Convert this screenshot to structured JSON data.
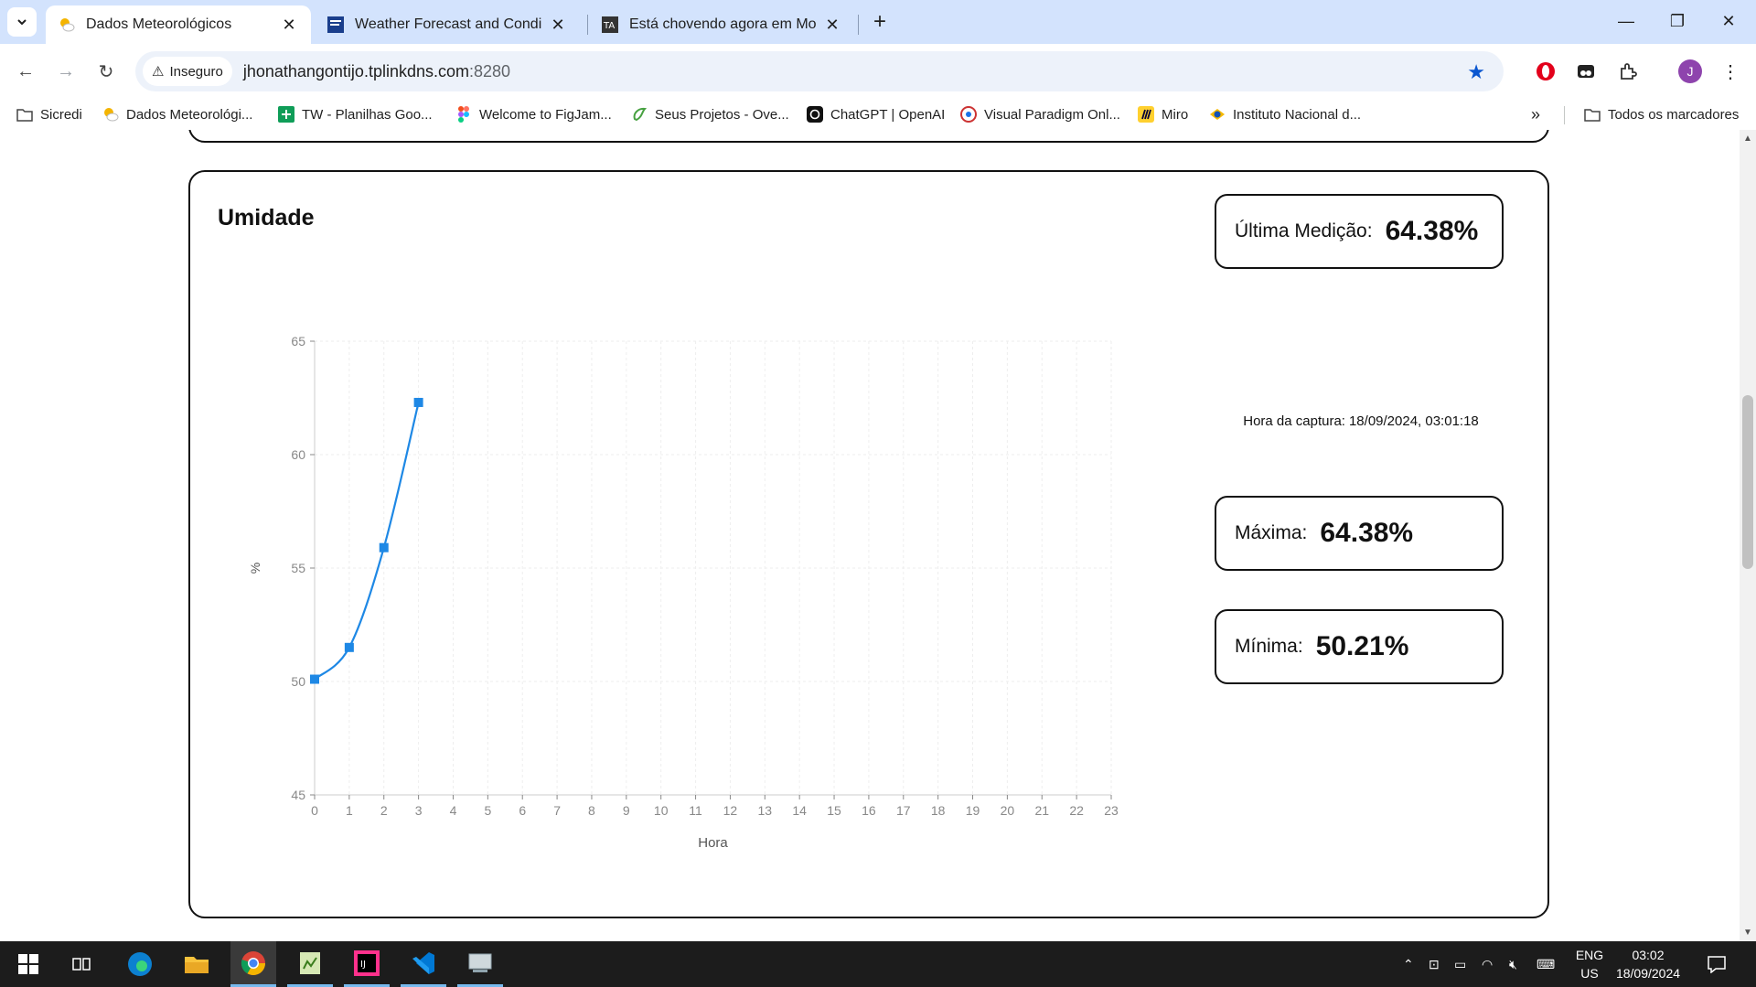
{
  "browser": {
    "tabs": [
      {
        "title": "Dados Meteorológicos",
        "active": true
      },
      {
        "title": "Weather Forecast and Conditions",
        "active": false
      },
      {
        "title": "Está chovendo agora em Montes Claros",
        "active": false
      }
    ],
    "security_label": "Inseguro",
    "url_host": "jhonathangontijo.tplinkdns.com",
    "url_port": ":8280",
    "profile_initial": "J",
    "bookmarks": [
      "Sicredi",
      "Dados Meteorológi...",
      "TW - Planilhas Goo...",
      "Welcome to FigJam...",
      "Seus Projetos - Ove...",
      "ChatGPT | OpenAI",
      "Visual Paradigm Onl...",
      "Miro",
      "Instituto Nacional d..."
    ],
    "all_bookmarks_label": "Todos os marcadores"
  },
  "card": {
    "title": "Umidade",
    "last_label": "Última Medição:",
    "last_value": "64.38%",
    "capture_label": "Hora da captura:",
    "capture_time": "18/09/2024, 03:01:18",
    "max_label": "Máxima:",
    "max_value": "64.38%",
    "min_label": "Mínima:",
    "min_value": "50.21%"
  },
  "chart_data": {
    "type": "line",
    "xlabel": "Hora",
    "ylabel": "%",
    "x_ticks": [
      0,
      1,
      2,
      3,
      4,
      5,
      6,
      7,
      8,
      9,
      10,
      11,
      12,
      13,
      14,
      15,
      16,
      17,
      18,
      19,
      20,
      21,
      22,
      23
    ],
    "xlim": [
      0,
      23
    ],
    "ylim": [
      45,
      65
    ],
    "y_ticks": [
      45,
      50,
      55,
      60,
      65
    ],
    "grid": true,
    "series": [
      {
        "x": [
          0,
          1,
          2,
          3
        ],
        "y": [
          50.1,
          51.5,
          55.9,
          62.3
        ],
        "color": "#1e88e5"
      }
    ]
  },
  "taskbar": {
    "lang_top": "ENG",
    "lang_bottom": "US",
    "time": "03:02",
    "date": "18/09/2024"
  }
}
